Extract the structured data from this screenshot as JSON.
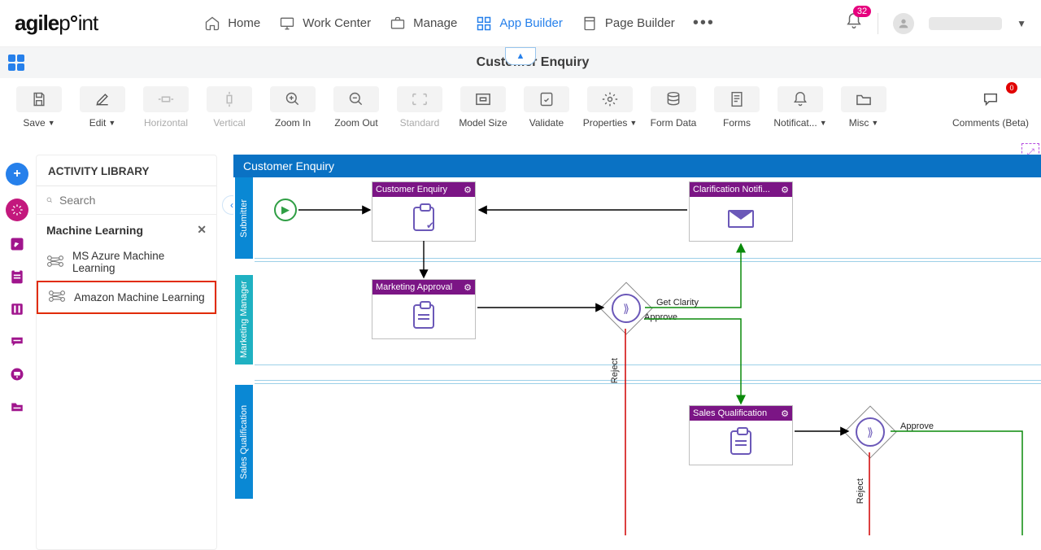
{
  "nav": {
    "logo": "agilepoint",
    "items": [
      {
        "label": "Home"
      },
      {
        "label": "Work Center"
      },
      {
        "label": "Manage"
      },
      {
        "label": "App Builder",
        "active": true
      },
      {
        "label": "Page Builder"
      }
    ],
    "notif_count": "32"
  },
  "page_title": "Customer Enquiry",
  "toolbar": {
    "save": "Save",
    "edit": "Edit",
    "horizontal": "Horizontal",
    "vertical": "Vertical",
    "zoom_in": "Zoom In",
    "zoom_out": "Zoom Out",
    "standard": "Standard",
    "model_size": "Model Size",
    "validate": "Validate",
    "properties": "Properties",
    "form_data": "Form Data",
    "forms": "Forms",
    "notifications": "Notificat...",
    "misc": "Misc",
    "comments": "Comments (Beta)",
    "comments_badge": "0"
  },
  "library": {
    "title": "ACTIVITY LIBRARY",
    "search_placeholder": "Search",
    "group": "Machine Learning",
    "items": [
      {
        "label": "MS Azure Machine Learning"
      },
      {
        "label": "Amazon Machine Learning",
        "selected": true
      }
    ]
  },
  "process": {
    "title": "Customer Enquiry",
    "lanes": {
      "submitter": "Submitter",
      "marketing": "Marketing Manager",
      "sales": "Sales Qualification"
    },
    "nodes": {
      "customer_enquiry": "Customer Enquiry",
      "clarification": "Clarification Notifi...",
      "marketing_approval": "Marketing Approval",
      "sales_qualification": "Sales Qualification"
    },
    "edges": {
      "get_clarity": "Get Clarity",
      "approve": "Approve",
      "reject": "Reject",
      "approve2": "Approve",
      "reject2": "Reject"
    }
  }
}
